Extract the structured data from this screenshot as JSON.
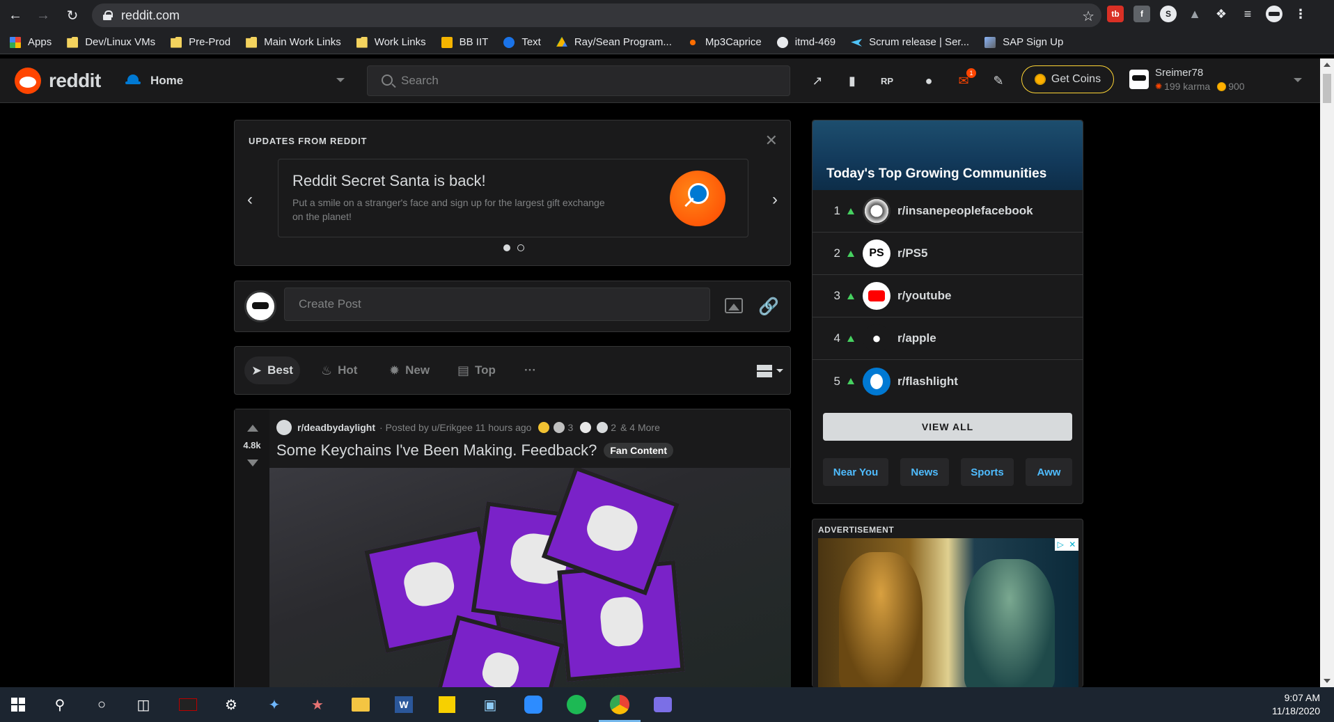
{
  "browser": {
    "url": "reddit.com",
    "bookmarks": [
      "Apps",
      "Dev/Linux VMs",
      "Pre-Prod",
      "Main Work Links",
      "Work Links",
      "BB IIT",
      "Text",
      "Ray/Sean Program...",
      "Mp3Caprice",
      "itmd-469",
      "Scrum release | Ser...",
      "SAP Sign Up"
    ],
    "extensions": [
      "tb-extension-icon",
      "facebook-icon",
      "s-extension-icon",
      "drive-icon",
      "puzzle-icon",
      "playlist-icon",
      "profile-icon",
      "menu-icon"
    ]
  },
  "header": {
    "logo_text": "reddit",
    "home_label": "Home",
    "search_placeholder": "Search",
    "mail_badge": "1",
    "get_coins_label": "Get Coins",
    "username": "Sreimer78",
    "karma": "199 karma",
    "coins": "900"
  },
  "updates": {
    "title": "UPDATES FROM REDDIT",
    "headline": "Reddit Secret Santa is back!",
    "body": "Put a smile on a stranger's face and sign up for the largest gift exchange on the planet!",
    "page_count": 2,
    "active_page": 1
  },
  "create_post": {
    "placeholder": "Create Post"
  },
  "sort": {
    "items": [
      "Best",
      "Hot",
      "New",
      "Top"
    ],
    "active": "Best",
    "more": "···"
  },
  "post": {
    "votes": "4.8k",
    "subreddit": "r/deadbydaylight",
    "posted_by": "· Posted by u/Erikgee 11 hours ago",
    "award_count": "3",
    "award_count_2": "2",
    "more_awards": "& 4 More",
    "title": "Some Keychains I've Been Making. Feedback?",
    "flair": "Fan Content"
  },
  "growing": {
    "title": "Today's Top Growing Communities",
    "communities": [
      {
        "rank": "1",
        "name": "r/insanepeoplefacebook"
      },
      {
        "rank": "2",
        "name": "r/PS5"
      },
      {
        "rank": "3",
        "name": "r/youtube"
      },
      {
        "rank": "4",
        "name": "r/apple"
      },
      {
        "rank": "5",
        "name": "r/flashlight"
      }
    ],
    "view_all": "VIEW ALL",
    "chips": [
      "Near You",
      "News",
      "Sports",
      "Aww"
    ]
  },
  "ad": {
    "label": "ADVERTISEMENT"
  },
  "taskbar": {
    "time": "9:07 AM",
    "date": "11/18/2020"
  },
  "colors": {
    "accent": "#ff4500",
    "link": "#4fbcff",
    "upvote_green": "#46d160",
    "coin_gold": "#ffd635"
  }
}
